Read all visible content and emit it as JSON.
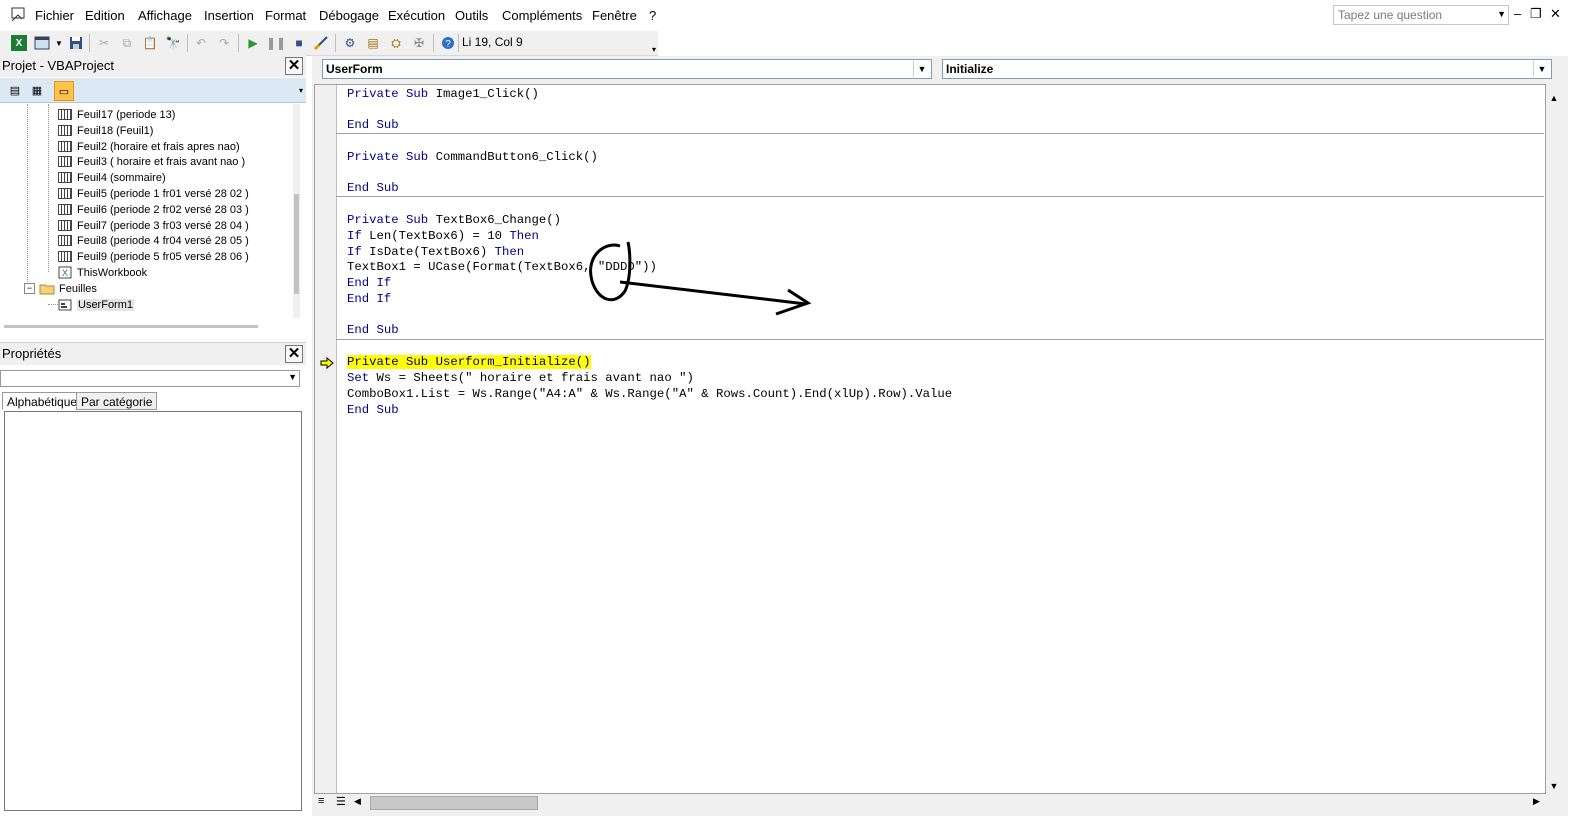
{
  "menu": {
    "items": [
      "Fichier",
      "Edition",
      "Affichage",
      "Insertion",
      "Format",
      "Débogage",
      "Exécution",
      "Outils",
      "Compléments",
      "Fenêtre",
      "?"
    ],
    "question_placeholder": "Tapez une question"
  },
  "toolbar": {
    "position": "Li 19, Col 9"
  },
  "project_pane": {
    "title": "Projet - VBAProject",
    "tree": [
      "Feuil17 (periode 13)",
      "Feuil18 (Feuil1)",
      "Feuil2 (horaire et frais apres nao)",
      "Feuil3 ( horaire et frais avant nao )",
      "Feuil4 (sommaire)",
      "Feuil5 (periode 1  fr01 versé 28  02 )",
      "Feuil6 (periode 2  fr02 versé 28  03 )",
      "Feuil7 (periode 3  fr03 versé 28  04 )",
      "Feuil8 (periode 4 fr04 versé 28  05 )",
      "Feuil9 (periode 5  fr05 versé 28  06 )",
      "ThisWorkbook"
    ],
    "folder": "Feuilles",
    "userform": "UserForm1"
  },
  "properties_pane": {
    "title": "Propriétés",
    "tabs": [
      "Alphabétique",
      "Par catégorie"
    ]
  },
  "code_window": {
    "object_combo": "UserForm",
    "procedure_combo": "Initialize",
    "lines": [
      {
        "kw1": "Private Sub",
        "rest": " Image1_Click()"
      },
      {
        "kw1": "End Sub",
        "rest": ""
      },
      {
        "kw1": "Private Sub",
        "rest": " CommandButton6_Click()"
      },
      {
        "kw1": "End Sub",
        "rest": ""
      },
      {
        "kw1": "Private Sub",
        "rest": " TextBox6_Change()"
      },
      {
        "kw1": "If",
        "mid": " Len(TextBox6) = 10 ",
        "kw2": "Then"
      },
      {
        "kw1": "If",
        "mid": " IsDate(TextBox6) ",
        "kw2": "Then"
      },
      {
        "kw1": "",
        "rest": "TextBox1 = UCase(Format(TextBox6, \"DDDD\"))"
      },
      {
        "kw1": "End If",
        "rest": ""
      },
      {
        "kw1": "End If",
        "rest": ""
      },
      {
        "kw1": "End Sub",
        "rest": ""
      },
      {
        "kw1": "Private Sub",
        "rest": " Userform_Initialize()"
      },
      {
        "kw1": "Set",
        "rest": " Ws = Sheets(\" horaire et frais avant nao \")"
      },
      {
        "kw1": "",
        "rest": "ComboBox1.List = Ws.Range(\"A4:A\" & Ws.Range(\"A\" & Rows.Count).End(xlUp).Row).Value"
      },
      {
        "kw1": "End Sub",
        "rest": ""
      }
    ]
  },
  "colors": {
    "keyword": "#00008b",
    "highlight": "#ffff00",
    "toolbar_bg": "#f0f0f0"
  }
}
